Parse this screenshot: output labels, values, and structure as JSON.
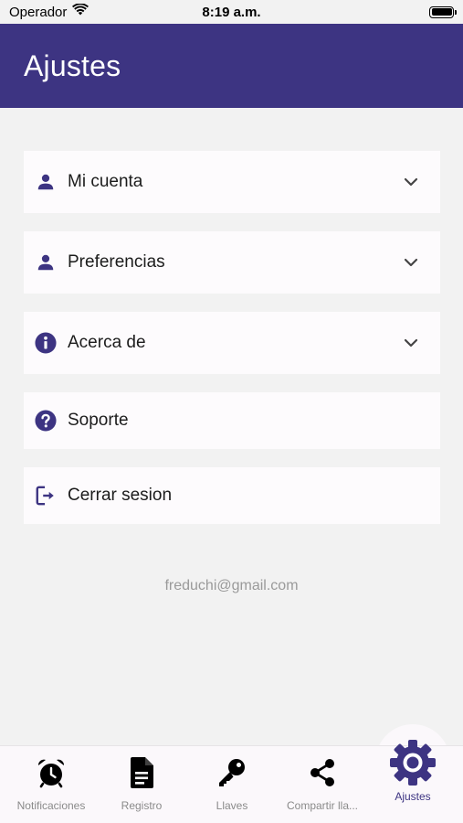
{
  "status_bar": {
    "carrier": "Operador",
    "time": "8:19 a.m."
  },
  "header": {
    "title": "Ajustes"
  },
  "menu": [
    {
      "label": "Mi cuenta",
      "icon": "person-icon",
      "expandable": true
    },
    {
      "label": "Preferencias",
      "icon": "person-icon",
      "expandable": true
    },
    {
      "label": "Acerca de",
      "icon": "info-icon",
      "expandable": true
    },
    {
      "label": "Soporte",
      "icon": "help-icon",
      "expandable": false
    },
    {
      "label": "Cerrar sesion",
      "icon": "logout-icon",
      "expandable": false
    }
  ],
  "user": {
    "email": "freduchi@gmail.com"
  },
  "tabs": [
    {
      "label": "Notificaciones",
      "icon": "alarm-clock-icon",
      "active": false
    },
    {
      "label": "Registro",
      "icon": "document-icon",
      "active": false
    },
    {
      "label": "Llaves",
      "icon": "key-icon",
      "active": false
    },
    {
      "label": "Compartir lla...",
      "icon": "share-icon",
      "active": false
    },
    {
      "label": "Ajustes",
      "icon": "gear-icon",
      "active": true
    }
  ],
  "colors": {
    "primary": "#3d3482",
    "background": "#f2f2f2",
    "card": "#fdfbfd",
    "muted_text": "#9a9a9a"
  }
}
